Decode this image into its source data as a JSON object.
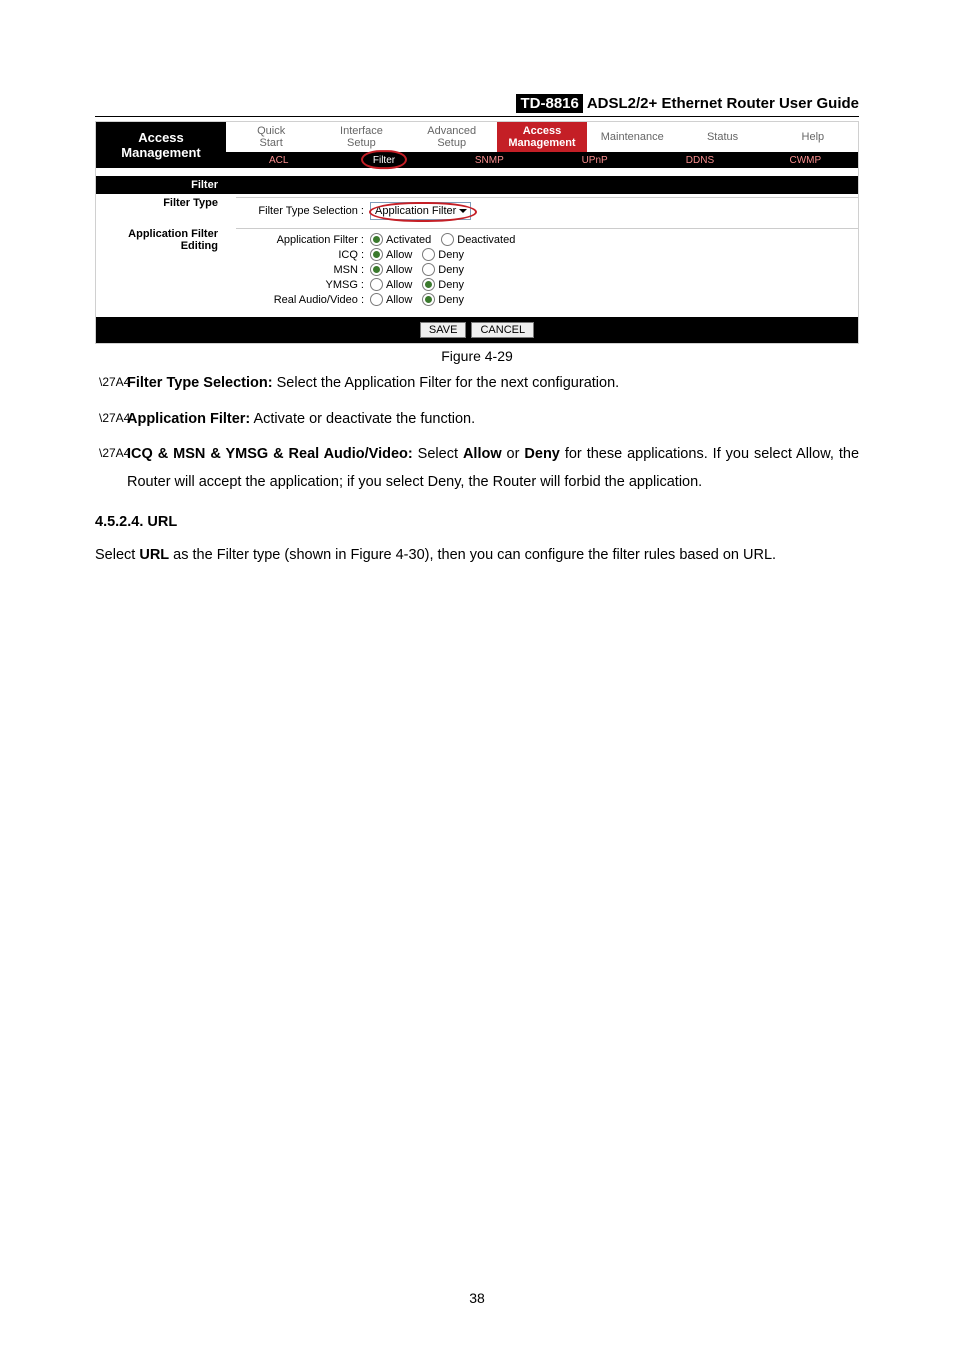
{
  "doc_header": {
    "model": "TD-8816",
    "title": "ADSL2/2+ Ethernet Router User Guide"
  },
  "router": {
    "left_title_line1": "Access",
    "left_title_line2": "Management",
    "tabs": {
      "quick_start_l1": "Quick",
      "quick_start_l2": "Start",
      "interface_l1": "Interface",
      "interface_l2": "Setup",
      "advanced_l1": "Advanced",
      "advanced_l2": "Setup",
      "access_l1": "Access",
      "access_l2": "Management",
      "maintenance": "Maintenance",
      "status": "Status",
      "help": "Help"
    },
    "subtabs": {
      "acl": "ACL",
      "filter": "Filter",
      "snmp": "SNMP",
      "upnp": "UPnP",
      "ddns": "DDNS",
      "cwmp": "CWMP"
    },
    "section_filter": "Filter",
    "section_filter_type": "Filter Type",
    "section_app_filter_editing": "Application Filter Editing",
    "filter_type_label": "Filter Type Selection :",
    "filter_type_value": "Application Filter",
    "rows": {
      "app_filter_label": "Application Filter :",
      "app_filter_opt1": "Activated",
      "app_filter_opt2": "Deactivated",
      "icq_label": "ICQ :",
      "msn_label": "MSN :",
      "ymsg_label": "YMSG :",
      "rav_label": "Real Audio/Video :",
      "allow": "Allow",
      "deny": "Deny"
    },
    "buttons": {
      "save": "SAVE",
      "cancel": "CANCEL"
    }
  },
  "figure_caption": "Figure 4-29",
  "bullets": {
    "b1_lead": "Filter Type Selection:",
    "b1_rest": " Select the Application Filter for the next configuration.",
    "b2_lead": "Application Filter:",
    "b2_rest": " Activate or deactivate the function.",
    "b3_lead": "ICQ & MSN & YMSG & Real Audio/Video:",
    "b3_rest_1": " Select ",
    "b3_allow": "Allow",
    "b3_or": " or ",
    "b3_deny": "Deny",
    "b3_rest_2": " for these applications. If you select Allow, the Router will accept the application; if you select Deny, the Router will forbid the application."
  },
  "section_heading": "4.5.2.4.  URL",
  "paragraph_1a": "Select ",
  "paragraph_url_bold": "URL",
  "paragraph_1b": " as the Filter type (shown in Figure 4-30), then you can configure the filter rules based on URL.",
  "page_number": "38"
}
